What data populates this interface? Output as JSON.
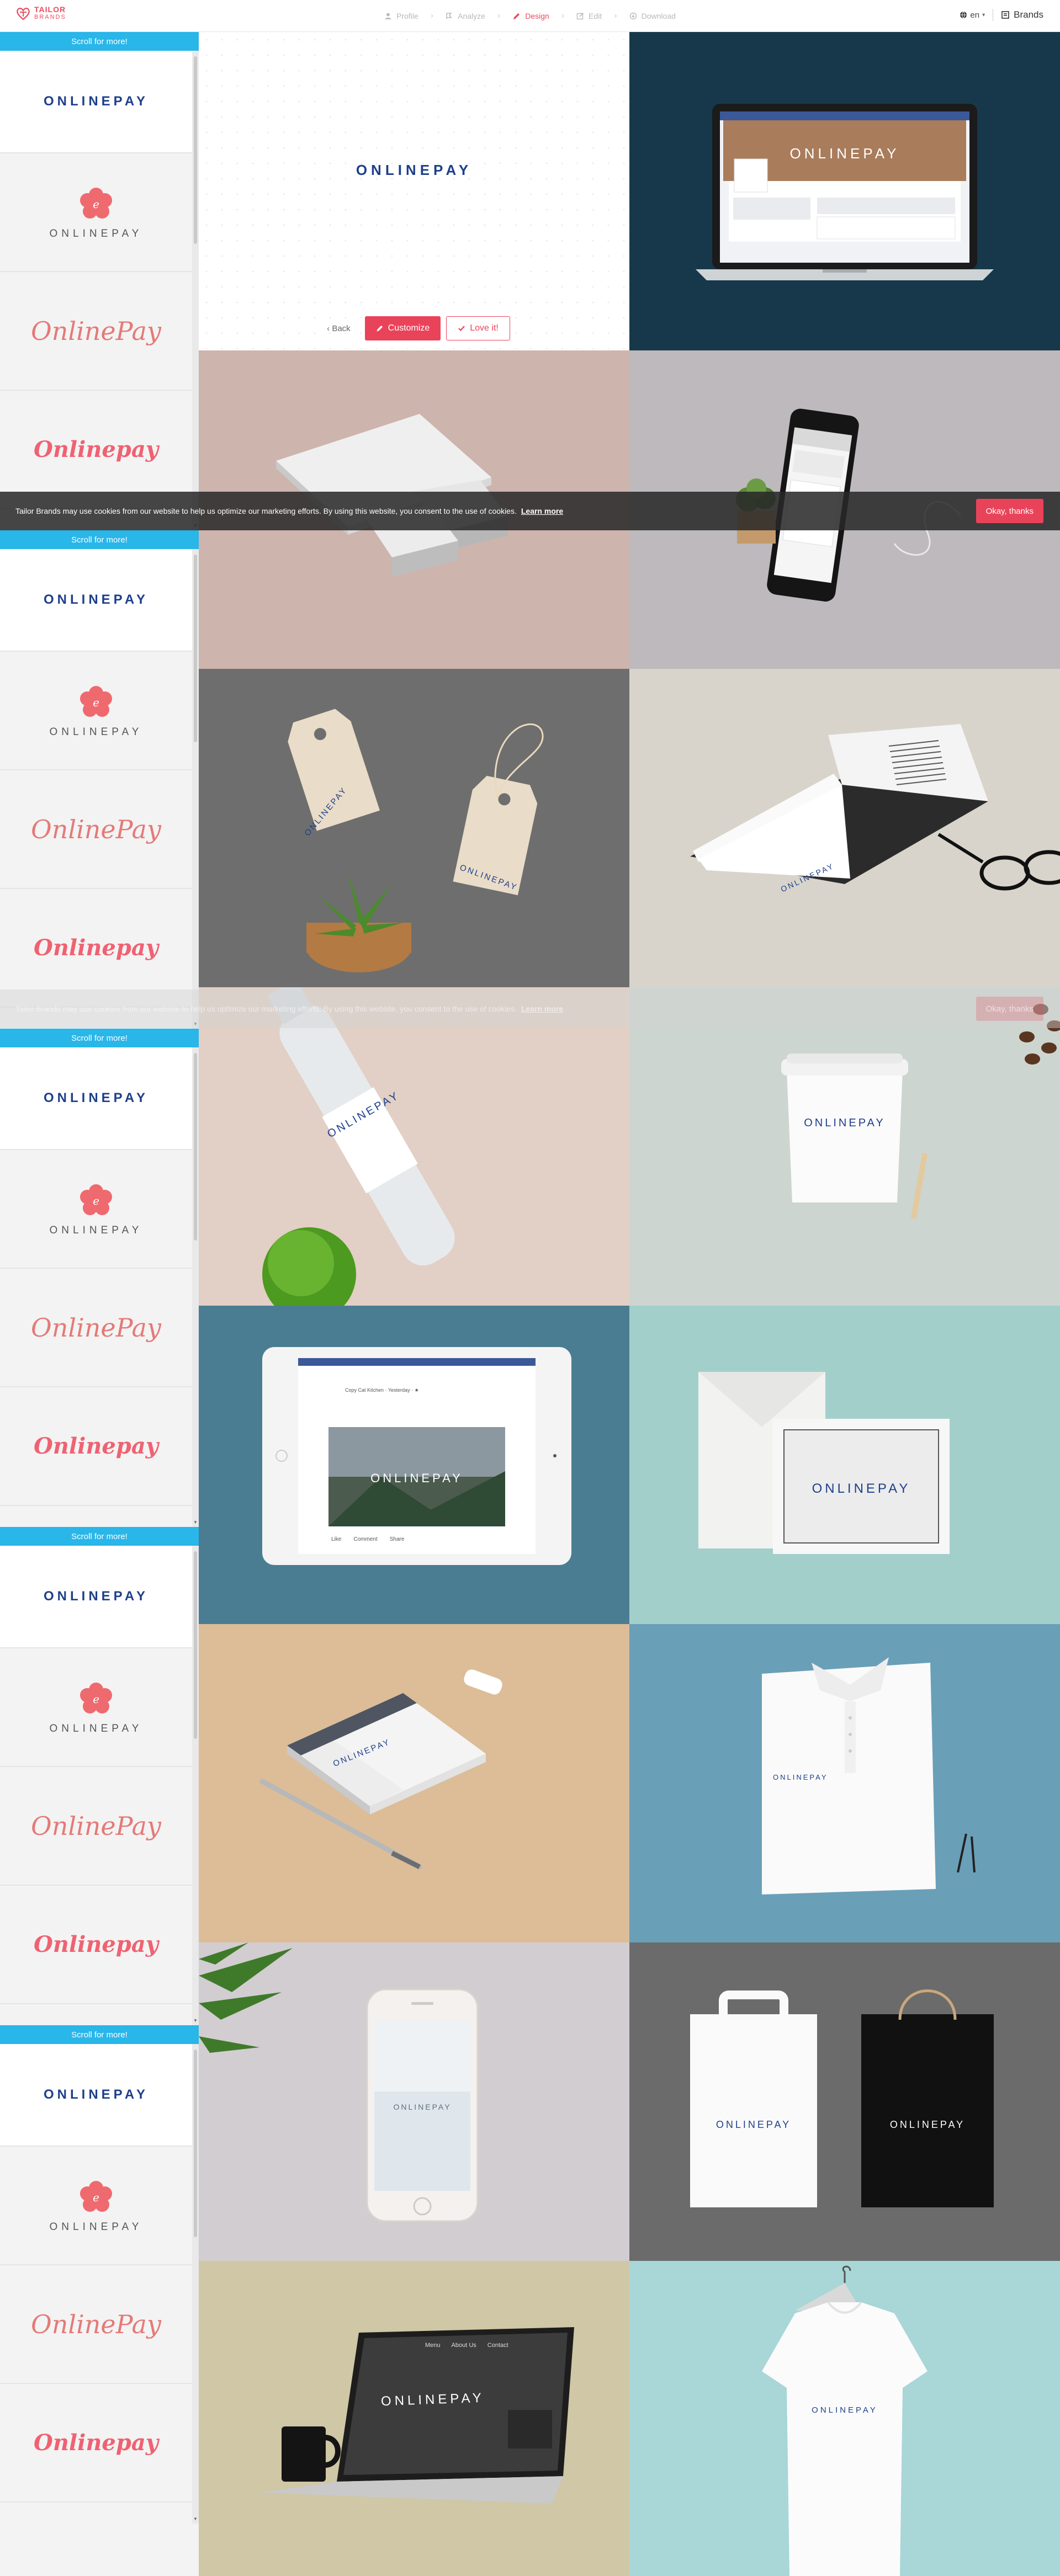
{
  "header": {
    "logo_line1": "TAILOR",
    "logo_line2": "BRANDS",
    "steps": [
      {
        "label": "Profile"
      },
      {
        "label": "Analyze"
      },
      {
        "label": "Design"
      },
      {
        "label": "Edit"
      },
      {
        "label": "Download"
      }
    ],
    "language": "en",
    "brands_label": "Brands"
  },
  "sidebar": {
    "scroll_more": "Scroll for more!",
    "logo_names": {
      "caps": "ONLINEPAY",
      "badge": "ONLINEPAY",
      "script": "OnlinePay",
      "script_bold": "Onlinepay"
    }
  },
  "hero": {
    "logo_text": "ONLINEPAY",
    "back_label": "Back",
    "customize_label": "Customize",
    "love_label": "Love it!"
  },
  "mockups": {
    "brand_text": "ONLINEPAY",
    "facebook_like": "Like",
    "facebook_comment": "Comment",
    "facebook_share": "Share",
    "facebook_header": "Copy Cat Kitchen · Yesterday · ★",
    "website_nav": [
      "Menu",
      "About Us",
      "Contact"
    ]
  },
  "cookie": {
    "message": "Tailor Brands may use cookies from our website to help us optimize our marketing efforts. By using this website, you consent to the use of cookies.",
    "learn_more": "Learn more",
    "ok_label": "Okay, thanks"
  },
  "colors": {
    "brand": "#e94c5f",
    "accent_blue": "#29b6e9",
    "logo_blue": "#1d3f8b"
  }
}
